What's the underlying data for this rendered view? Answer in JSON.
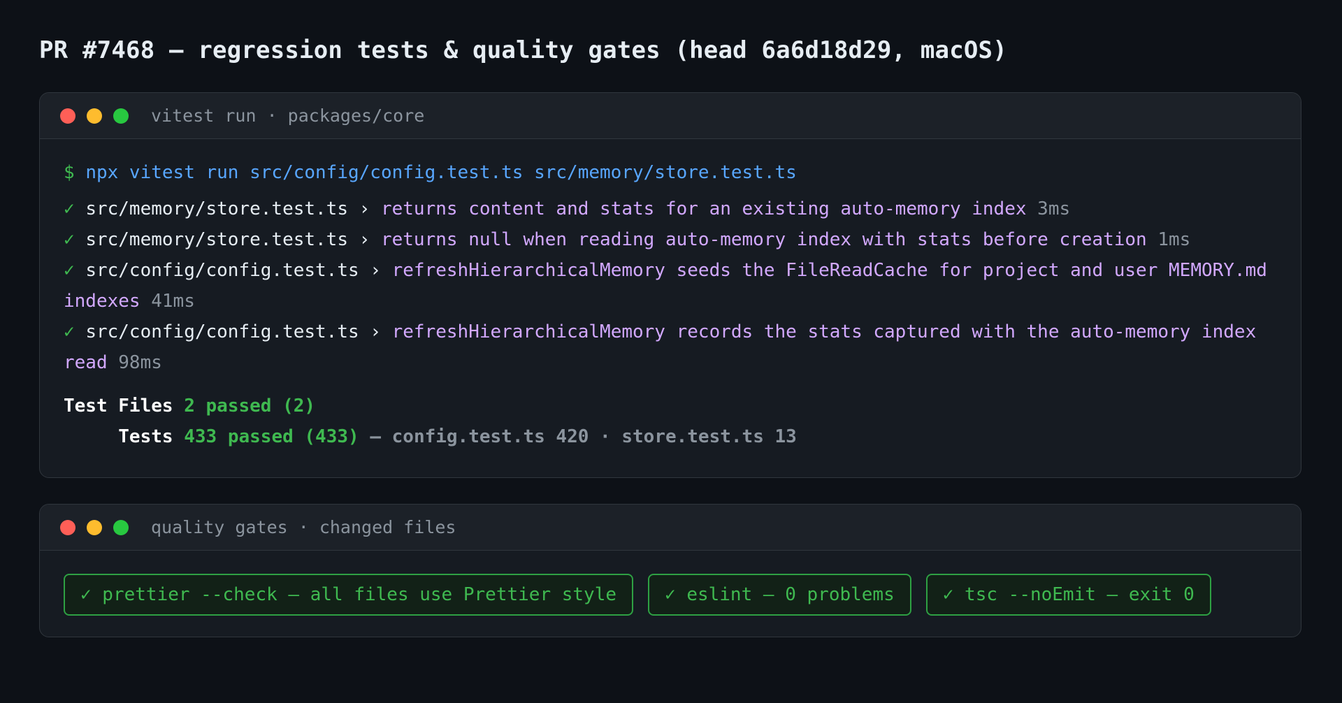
{
  "page": {
    "title": "PR #7468 — regression tests & quality gates (head 6a6d18d29, macOS)"
  },
  "tests_panel": {
    "title": "vitest run · packages/core",
    "prompt": "$",
    "command": "npx vitest run src/config/config.test.ts src/memory/store.test.ts",
    "results": [
      {
        "mark": "✓",
        "file": "src/memory/store.test.ts",
        "sep": "›",
        "name": "returns content and stats for an existing auto-memory index",
        "duration": "3ms"
      },
      {
        "mark": "✓",
        "file": "src/memory/store.test.ts",
        "sep": "›",
        "name": "returns null when reading auto-memory index with stats before creation",
        "duration": "1ms"
      },
      {
        "mark": "✓",
        "file": "src/config/config.test.ts",
        "sep": "›",
        "name": "refreshHierarchicalMemory seeds the FileReadCache for project and user MEMORY.md indexes",
        "duration": "41ms"
      },
      {
        "mark": "✓",
        "file": "src/config/config.test.ts",
        "sep": "›",
        "name": "refreshHierarchicalMemory records the stats captured with the auto-memory index read",
        "duration": "98ms"
      }
    ],
    "summary": {
      "files_label": "Test Files",
      "files_value": "2 passed (2)",
      "tests_label": "Tests",
      "tests_value": "433 passed (433)",
      "tests_detail": "— config.test.ts 420 · store.test.ts 13"
    }
  },
  "gates_panel": {
    "title": "quality gates · changed files",
    "gates": [
      "✓ prettier --check — all files use Prettier style",
      "✓ eslint — 0 problems",
      "✓ tsc --noEmit — exit 0"
    ]
  },
  "colors": {
    "background": "#0d1117",
    "panel": "#161b22",
    "pass_green": "#3fb950",
    "command_blue": "#58a6ff",
    "test_name_purple": "#d2a8ff",
    "muted_gray": "#8b949e"
  }
}
